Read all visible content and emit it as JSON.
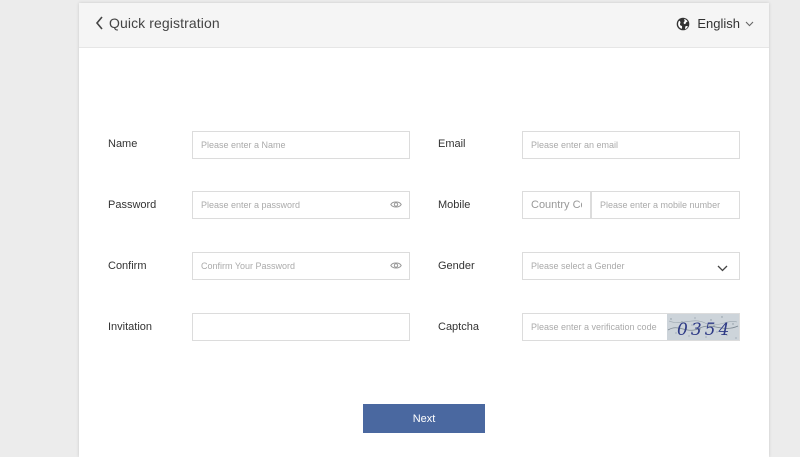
{
  "header": {
    "title": "Quick registration",
    "language": "English"
  },
  "form": {
    "name_label": "Name",
    "name_placeholder": "Please enter a Name",
    "email_label": "Email",
    "email_placeholder": "Please enter an email",
    "password_label": "Password",
    "password_placeholder": "Please enter a password",
    "mobile_label": "Mobile",
    "country_code_placeholder": "Country Code",
    "mobile_placeholder": "Please enter a mobile number",
    "confirm_label": "Confirm",
    "confirm_placeholder": "Confirm Your Password",
    "gender_label": "Gender",
    "gender_placeholder": "Please select a Gender",
    "invitation_label": "Invitation",
    "invitation_value": "",
    "captcha_label": "Captcha",
    "captcha_placeholder": "Please enter a verification code",
    "captcha_text": "0354"
  },
  "actions": {
    "next_label": "Next"
  },
  "colors": {
    "button": "#4a68a0",
    "background": "#ececec",
    "header": "#f5f5f5"
  }
}
